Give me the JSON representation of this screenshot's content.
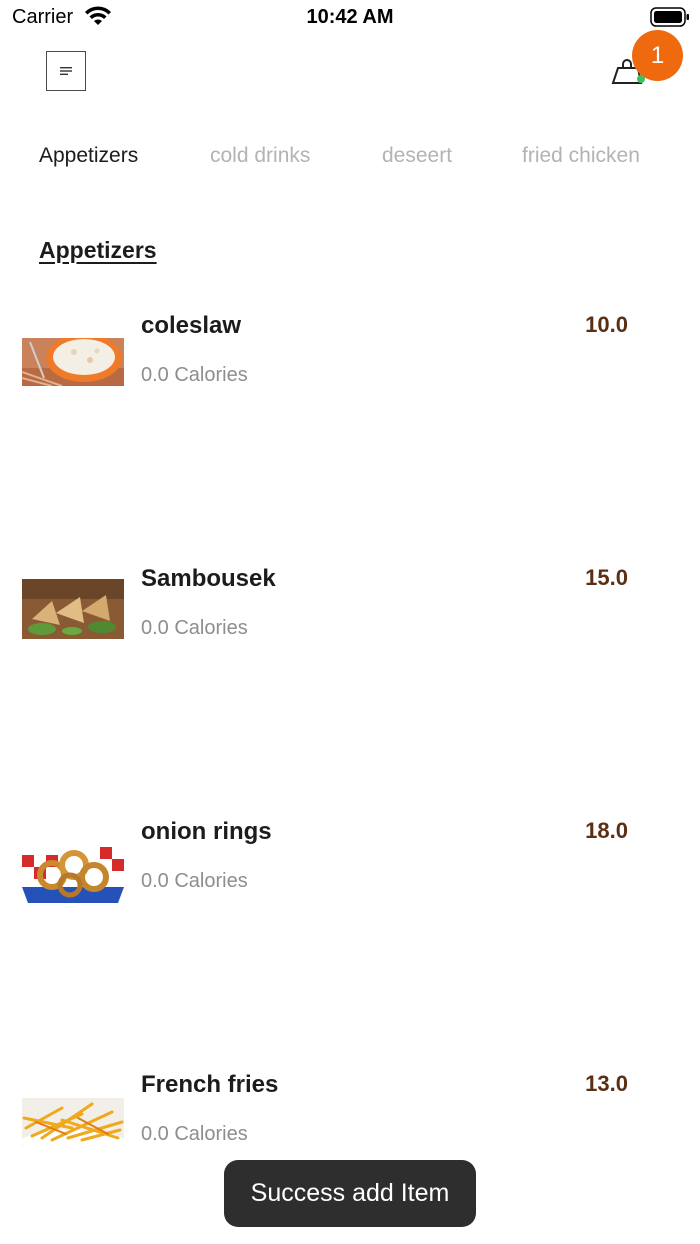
{
  "status_bar": {
    "carrier": "Carrier",
    "time": "10:42 AM"
  },
  "header": {
    "menu_icon": "menu-lines-icon",
    "cart_icon": "shopping-cart-icon",
    "cart_count": "1",
    "badge_color": "#ef6a0f"
  },
  "tabs": [
    {
      "label": "Appetizers",
      "active": true
    },
    {
      "label": "cold drinks",
      "active": false
    },
    {
      "label": "deseert",
      "active": false
    },
    {
      "label": "fried chicken",
      "active": false
    }
  ],
  "section": {
    "title": "Appetizers"
  },
  "items": [
    {
      "name": "coleslaw",
      "calories": "0.0 Calories",
      "price": "10.0",
      "image": "coleslaw-photo"
    },
    {
      "name": "Sambousek",
      "calories": "0.0 Calories",
      "price": "15.0",
      "image": "sambousek-photo"
    },
    {
      "name": "onion rings",
      "calories": "0.0 Calories",
      "price": "18.0",
      "image": "onion-rings-photo"
    },
    {
      "name": "French fries",
      "calories": "0.0 Calories",
      "price": "13.0",
      "image": "french-fries-photo"
    }
  ],
  "toast": {
    "message": "Success add Item"
  },
  "colors": {
    "price": "#5a2f14",
    "inactive_tab": "#b3b3b3",
    "calories": "#8e8e8e"
  }
}
